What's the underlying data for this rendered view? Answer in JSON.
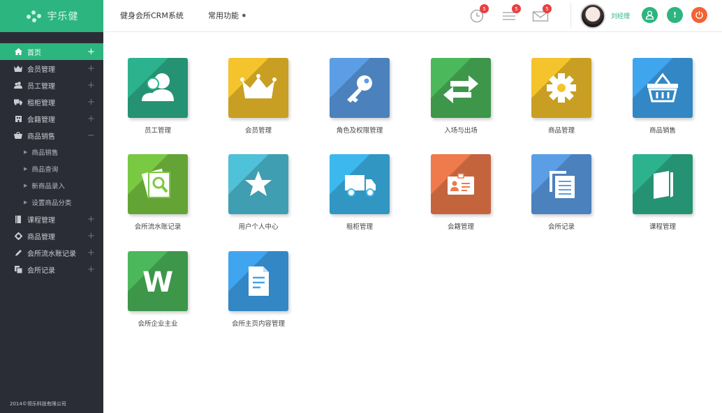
{
  "app": {
    "logo_text": "宇乐健",
    "title": "健身会所CRM系统",
    "common_functions": "常用功能",
    "footer": "2014©领乐科技有限公司"
  },
  "header": {
    "clock_badge": "5",
    "list_badge": "5",
    "mail_badge": "5",
    "username": "刘经理",
    "colors": {
      "user": "#2db57f",
      "alert": "#2db57f",
      "power": "#f26434"
    }
  },
  "sidebar": {
    "items": [
      {
        "label": "首页",
        "icon": "home-icon",
        "toggle": "+",
        "active": true
      },
      {
        "label": "会员管理",
        "icon": "crown-icon",
        "toggle": "+"
      },
      {
        "label": "员工管理",
        "icon": "users-icon",
        "toggle": "+"
      },
      {
        "label": "租柜管理",
        "icon": "truck-icon",
        "toggle": "+"
      },
      {
        "label": "会籍管理",
        "icon": "building-icon",
        "toggle": "+"
      },
      {
        "label": "商品销售",
        "icon": "basket-icon",
        "toggle": "−"
      },
      {
        "label": "课程管理",
        "icon": "book-icon",
        "toggle": "+"
      },
      {
        "label": "商品管理",
        "icon": "gear-icon",
        "toggle": "+"
      },
      {
        "label": "会所流水账记录",
        "icon": "pen-icon",
        "toggle": "+"
      },
      {
        "label": "会所记录",
        "icon": "copy-icon",
        "toggle": "+"
      }
    ],
    "sub_items": [
      "商品销售",
      "商品查询",
      "新商品录入",
      "设置商品分类"
    ]
  },
  "tiles": [
    {
      "label": "员工管理",
      "color": "#2cb38d",
      "icon": "users-icon"
    },
    {
      "label": "会员管理",
      "color": "#f5c32b",
      "icon": "crown-icon"
    },
    {
      "label": "角色及权限管理",
      "color": "#5c9ee6",
      "icon": "key-icon"
    },
    {
      "label": "入场与出场",
      "color": "#4cb85c",
      "icon": "exchange-icon"
    },
    {
      "label": "商品管理",
      "color": "#f5c32b",
      "icon": "gear-icon"
    },
    {
      "label": "商品销售",
      "color": "#3fa5ef",
      "icon": "basket-icon"
    },
    {
      "label": "会所流水账记录",
      "color": "#7ac943",
      "icon": "search-doc-icon"
    },
    {
      "label": "用户个人中心",
      "color": "#4fc1d9",
      "icon": "star-icon"
    },
    {
      "label": "租柜管理",
      "color": "#3db8ee",
      "icon": "truck-icon"
    },
    {
      "label": "会籍管理",
      "color": "#ef7a4b",
      "icon": "id-card-icon"
    },
    {
      "label": "会所记录",
      "color": "#5c9ee6",
      "icon": "copy-icon"
    },
    {
      "label": "课程管理",
      "color": "#2cb38d",
      "icon": "book-icon"
    },
    {
      "label": "会所企业主业",
      "color": "#4cb85c",
      "icon": "word-icon",
      "letter": "W"
    },
    {
      "label": "会所主页内容管理",
      "color": "#3fa5ef",
      "icon": "document-icon"
    }
  ]
}
